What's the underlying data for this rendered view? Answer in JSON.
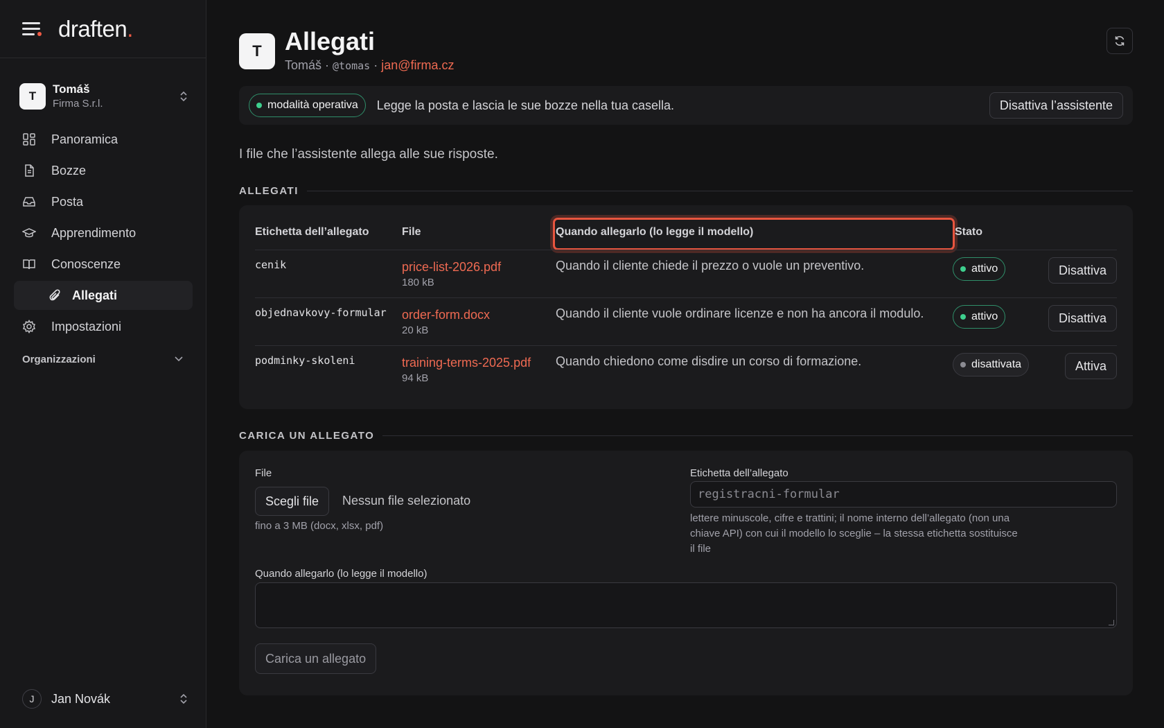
{
  "brand": {
    "name": "draften",
    "dot": "."
  },
  "org": {
    "initial": "T",
    "name": "Tomáš",
    "company": "Firma S.r.l."
  },
  "nav": {
    "items": [
      {
        "label": "Panoramica",
        "icon": "dashboard-icon"
      },
      {
        "label": "Bozze",
        "icon": "document-icon"
      },
      {
        "label": "Posta",
        "icon": "inbox-icon"
      },
      {
        "label": "Apprendimento",
        "icon": "graduation-cap-icon"
      },
      {
        "label": "Conoscenze",
        "icon": "book-icon"
      },
      {
        "label": "Allegati",
        "icon": "paperclip-icon",
        "active": true
      },
      {
        "label": "Impostazioni",
        "icon": "gear-icon"
      }
    ],
    "section": "Organizzazioni"
  },
  "user": {
    "initial": "J",
    "name": "Jan Novák"
  },
  "header": {
    "avatar_initial": "T",
    "title": "Allegati",
    "name": "Tomáš",
    "sep1": " · ",
    "handle": "@tomas",
    "sep2": " · ",
    "email": "jan@firma.cz"
  },
  "mode_bar": {
    "badge": "modalità operativa",
    "text": "Legge la posta e lascia le sue bozze nella tua casella.",
    "button": "Disattiva l’assistente"
  },
  "intro": "I file che l’assistente allega alle sue risposte.",
  "attachments": {
    "section_title": "ALLEGATI",
    "columns": [
      "Etichetta dell’allegato",
      "File",
      "Quando allegarlo (lo legge il modello)",
      "Stato"
    ],
    "rows": [
      {
        "label": "cenik",
        "file": "price-list-2026.pdf",
        "size": "180 kB",
        "when": "Quando il cliente chiede il prezzo o vuole un preventivo.",
        "status": "attivo",
        "action": "Disattiva"
      },
      {
        "label": "objednavkovy-formular",
        "file": "order-form.docx",
        "size": "20 kB",
        "when": "Quando il cliente vuole ordinare licenze e non ha ancora il modulo.",
        "status": "attivo",
        "action": "Disattiva"
      },
      {
        "label": "podminky-skoleni",
        "file": "training-terms-2025.pdf",
        "size": "94 kB",
        "when": "Quando chiedono come disdire un corso di formazione.",
        "status": "disattivata",
        "action": "Attiva"
      }
    ]
  },
  "upload": {
    "section_title": "CARICA UN ALLEGATO",
    "file_label": "File",
    "choose_button": "Scegli file",
    "no_file": "Nessun file selezionato",
    "file_hint": "fino a 3 MB (docx, xlsx, pdf)",
    "tag_label": "Etichetta dell’allegato",
    "tag_placeholder": "registracni-formular",
    "tag_hint_1": "lettere minuscole, cifre e trattini; il nome interno dell’allegato (non una",
    "tag_hint_2": "chiave API) con cui il modello lo sceglie – la stessa etichetta sostituisce",
    "tag_hint_3": "il file",
    "when_label": "Quando allegarlo (lo legge il modello)",
    "submit": "Carica un allegato"
  },
  "colors": {
    "accent": "#ef5a45",
    "active": "#3ecf8e",
    "inactive": "#8b8b92"
  }
}
